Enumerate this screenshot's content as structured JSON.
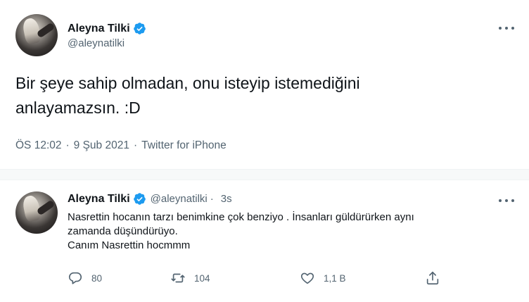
{
  "main_tweet": {
    "display_name": "Aleyna Tilki",
    "handle": "@aleynatilki",
    "text_line1": "Bir şeye sahip olmadan, onu isteyip istemediğini",
    "text_line2": "anlayamazsın. :D",
    "time": "ÖS 12:02",
    "date": "9 Şub 2021",
    "source": "Twitter for iPhone",
    "separator": "·"
  },
  "reply_tweet": {
    "display_name": "Aleyna Tilki",
    "handle": "@aleynatilki",
    "separator": "·",
    "age": "3s",
    "text_line1": "Nasrettin hocanın tarzı benimkine çok benziyo . İnsanları güldürürken aynı",
    "text_line2": "zamanda düşündürüyo.",
    "text_line3": "Canım Nasrettin hocmmm",
    "reply_count": "80",
    "retweet_count": "104",
    "like_count": "1,1 B"
  },
  "icons": {
    "verified": "verified-badge-icon",
    "more": "more-options-icon",
    "reply": "reply-icon",
    "retweet": "retweet-icon",
    "like": "heart-icon",
    "share": "share-icon"
  },
  "colors": {
    "verified_blue": "#1d9bf0",
    "secondary_text": "#536471",
    "primary_text": "#0f1419"
  }
}
